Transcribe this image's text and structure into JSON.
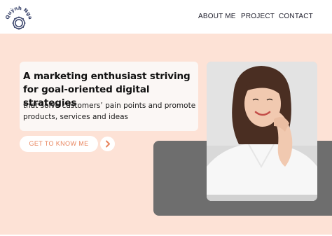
{
  "header": {
    "logo_text": "Quỳnh Nga",
    "nav": [
      {
        "label": "ABOUT ME"
      },
      {
        "label": "PROJECT"
      },
      {
        "label": "CONTACT"
      }
    ]
  },
  "hero": {
    "headline": "A marketing enthusiast striving for goal-oriented digital strategies",
    "subline": "that solve customers’ pain points and promote products, services and ideas",
    "cta_label": "GET TO KNOW ME",
    "arrow_glyph": "›",
    "photo_icon": "portrait-photo"
  },
  "colors": {
    "hero_background": "#fde2d6",
    "accent": "#e8855e",
    "panel_gray": "#6e6e6e",
    "logo_navy": "#2f3a63"
  }
}
